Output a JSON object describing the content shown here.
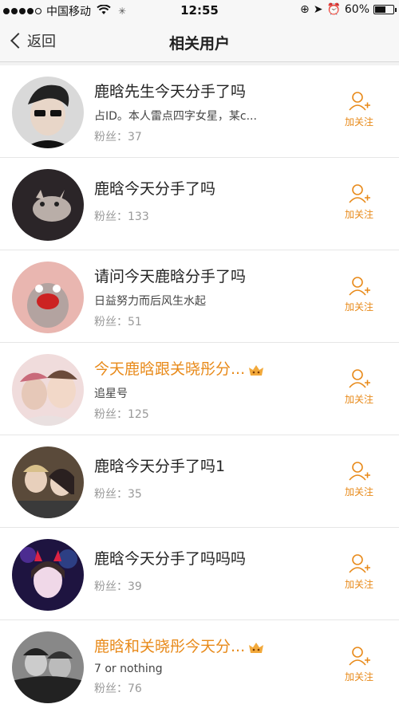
{
  "status_bar": {
    "carrier": "中国移动",
    "time": "12:55",
    "battery_percent": "60%",
    "battery_level": 0.6
  },
  "nav": {
    "back_label": "返回",
    "title": "相关用户"
  },
  "follow_label": "加关注",
  "fans_prefix": "粉丝：",
  "users": [
    {
      "name": "鹿晗先生今天分手了吗",
      "desc": "占ID。本人雷点四字女星，某c...",
      "fans": "37",
      "highlight": false
    },
    {
      "name": "鹿晗今天分手了吗",
      "desc": "",
      "fans": "133",
      "highlight": false
    },
    {
      "name": "请问今天鹿晗分手了吗",
      "desc": "日益努力而后风生水起",
      "fans": "51",
      "highlight": false
    },
    {
      "name": "今天鹿晗跟关晓彤分...",
      "desc": "追星号",
      "fans": "125",
      "highlight": true
    },
    {
      "name": "鹿晗今天分手了吗1",
      "desc": "",
      "fans": "35",
      "highlight": false
    },
    {
      "name": "鹿晗今天分手了吗吗吗",
      "desc": "",
      "fans": "39",
      "highlight": false
    },
    {
      "name": "鹿晗和关晓彤今天分...",
      "desc": "7 or nothing",
      "fans": "76",
      "highlight": true
    }
  ],
  "colors": {
    "accent": "#e88a1a"
  }
}
